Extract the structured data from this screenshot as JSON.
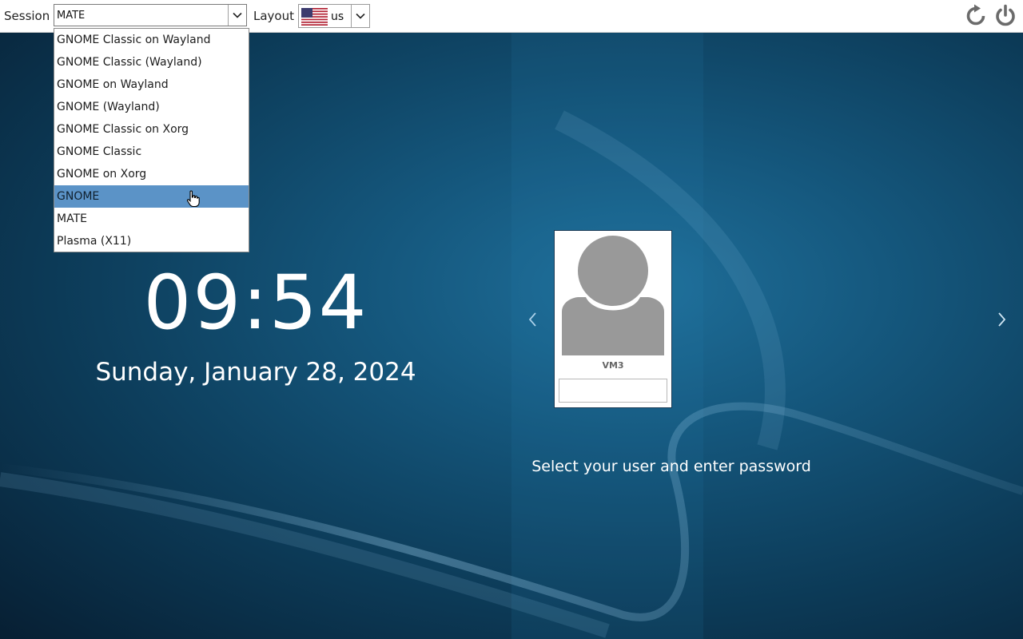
{
  "topbar": {
    "session_label": "Session",
    "session_value": "MATE",
    "layout_label": "Layout",
    "layout_value": "us",
    "layout_flag_icon": "us-flag-icon",
    "reboot_icon": "reboot-icon",
    "power_icon": "power-icon"
  },
  "session_menu": {
    "items": [
      "GNOME Classic on Wayland",
      "GNOME Classic (Wayland)",
      "GNOME on Wayland",
      "GNOME (Wayland)",
      "GNOME Classic on Xorg",
      "GNOME Classic",
      "GNOME on Xorg",
      "GNOME",
      "MATE",
      "Plasma (X11)"
    ],
    "highlighted": "GNOME"
  },
  "clock": {
    "time": "09:54",
    "date": "Sunday, January 28, 2024"
  },
  "user": {
    "name": "VM3",
    "password_value": ""
  },
  "instruction": "Select your user and enter password",
  "colors": {
    "highlight": "#5b93c7",
    "icon_gray": "#666666"
  }
}
